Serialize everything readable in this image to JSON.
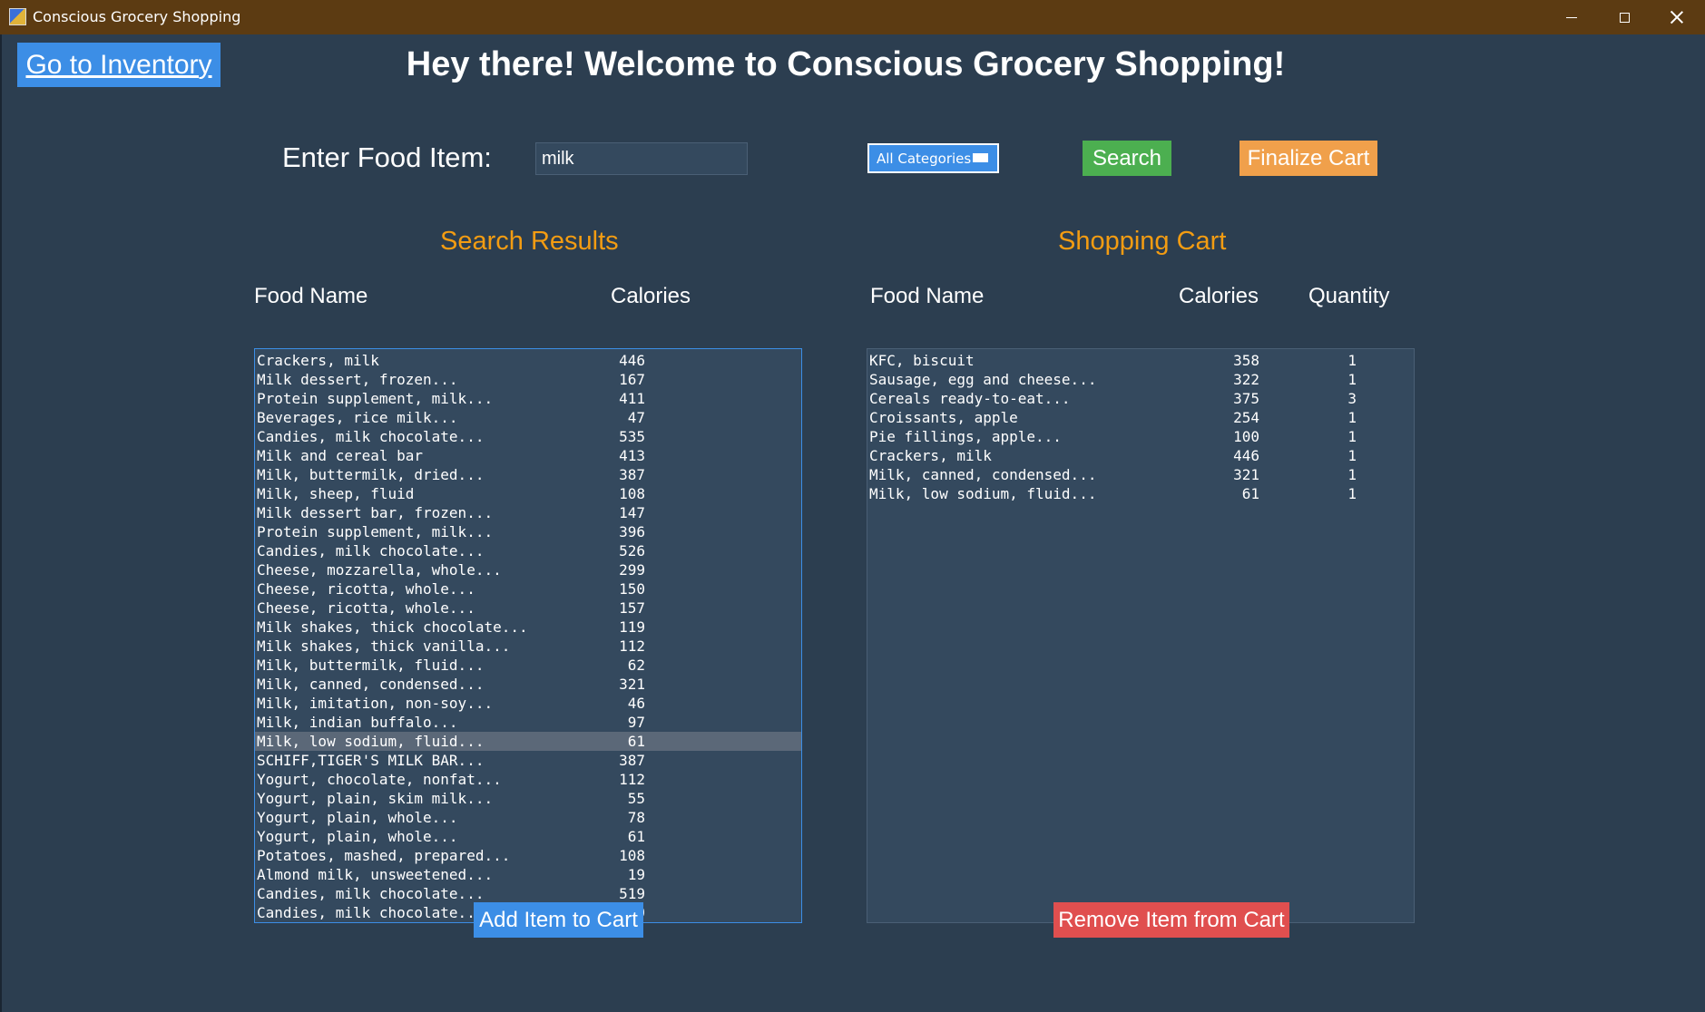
{
  "window": {
    "title": "Conscious Grocery Shopping",
    "icon": "app-icon"
  },
  "header": {
    "inventory_button": "Go to Inventory",
    "welcome": "Hey there! Welcome to Conscious Grocery Shopping!"
  },
  "search": {
    "label": "Enter Food Item:",
    "value": "milk",
    "category": "All Categories",
    "search_button": "Search",
    "finalize_button": "Finalize Cart"
  },
  "results": {
    "title": "Search Results",
    "col_name": "Food Name",
    "col_calories": "Calories",
    "selected_index": 20,
    "rows": [
      {
        "name": "Crackers, milk",
        "calories": "446"
      },
      {
        "name": "Milk dessert, frozen...",
        "calories": "167"
      },
      {
        "name": "Protein supplement, milk...",
        "calories": "411"
      },
      {
        "name": "Beverages, rice milk...",
        "calories": "47"
      },
      {
        "name": "Candies, milk chocolate...",
        "calories": "535"
      },
      {
        "name": "Milk and cereal bar",
        "calories": "413"
      },
      {
        "name": "Milk, buttermilk, dried...",
        "calories": "387"
      },
      {
        "name": "Milk, sheep, fluid",
        "calories": "108"
      },
      {
        "name": "Milk dessert bar, frozen...",
        "calories": "147"
      },
      {
        "name": "Protein supplement, milk...",
        "calories": "396"
      },
      {
        "name": "Candies, milk chocolate...",
        "calories": "526"
      },
      {
        "name": "Cheese, mozzarella, whole...",
        "calories": "299"
      },
      {
        "name": "Cheese, ricotta, whole...",
        "calories": "150"
      },
      {
        "name": "Cheese, ricotta, whole...",
        "calories": "157"
      },
      {
        "name": "Milk shakes, thick chocolate...",
        "calories": "119"
      },
      {
        "name": "Milk shakes, thick vanilla...",
        "calories": "112"
      },
      {
        "name": "Milk, buttermilk, fluid...",
        "calories": "62"
      },
      {
        "name": "Milk, canned, condensed...",
        "calories": "321"
      },
      {
        "name": "Milk, imitation, non-soy...",
        "calories": "46"
      },
      {
        "name": "Milk, indian buffalo...",
        "calories": "97"
      },
      {
        "name": "Milk, low sodium, fluid...",
        "calories": "61"
      },
      {
        "name": "SCHIFF,TIGER'S MILK BAR...",
        "calories": "387"
      },
      {
        "name": "Yogurt, chocolate, nonfat...",
        "calories": "112"
      },
      {
        "name": "Yogurt, plain, skim milk...",
        "calories": "55"
      },
      {
        "name": "Yogurt, plain, whole...",
        "calories": "78"
      },
      {
        "name": "Yogurt, plain, whole...",
        "calories": "61"
      },
      {
        "name": "Potatoes, mashed, prepared...",
        "calories": "108"
      },
      {
        "name": "Almond milk, unsweetened...",
        "calories": "19"
      },
      {
        "name": "Candies, milk chocolate...",
        "calories": "519"
      },
      {
        "name": "Candies, milk chocolate...",
        "calories": "389"
      }
    ],
    "add_button": "Add Item to Cart"
  },
  "cart": {
    "title": "Shopping Cart",
    "col_name": "Food Name",
    "col_calories": "Calories",
    "col_quantity": "Quantity",
    "rows": [
      {
        "name": "KFC, biscuit",
        "calories": "358",
        "quantity": "1"
      },
      {
        "name": "Sausage, egg and cheese...",
        "calories": "322",
        "quantity": "1"
      },
      {
        "name": "Cereals ready-to-eat...",
        "calories": "375",
        "quantity": "3"
      },
      {
        "name": "Croissants, apple",
        "calories": "254",
        "quantity": "1"
      },
      {
        "name": "Pie fillings, apple...",
        "calories": "100",
        "quantity": "1"
      },
      {
        "name": "Crackers, milk",
        "calories": "446",
        "quantity": "1"
      },
      {
        "name": "Milk, canned, condensed...",
        "calories": "321",
        "quantity": "1"
      },
      {
        "name": "Milk, low sodium, fluid...",
        "calories": "61",
        "quantity": "1"
      }
    ],
    "remove_button": "Remove Item from Cart"
  },
  "colors": {
    "background": "#2c3e50",
    "titlebar": "#5c3b12",
    "accent_blue": "#3c8ee6",
    "search_green": "#4caf50",
    "finalize_orange": "#f0a04b",
    "section_title_orange": "#f39c12",
    "remove_red": "#e04f4f",
    "list_bg": "#34495e"
  }
}
